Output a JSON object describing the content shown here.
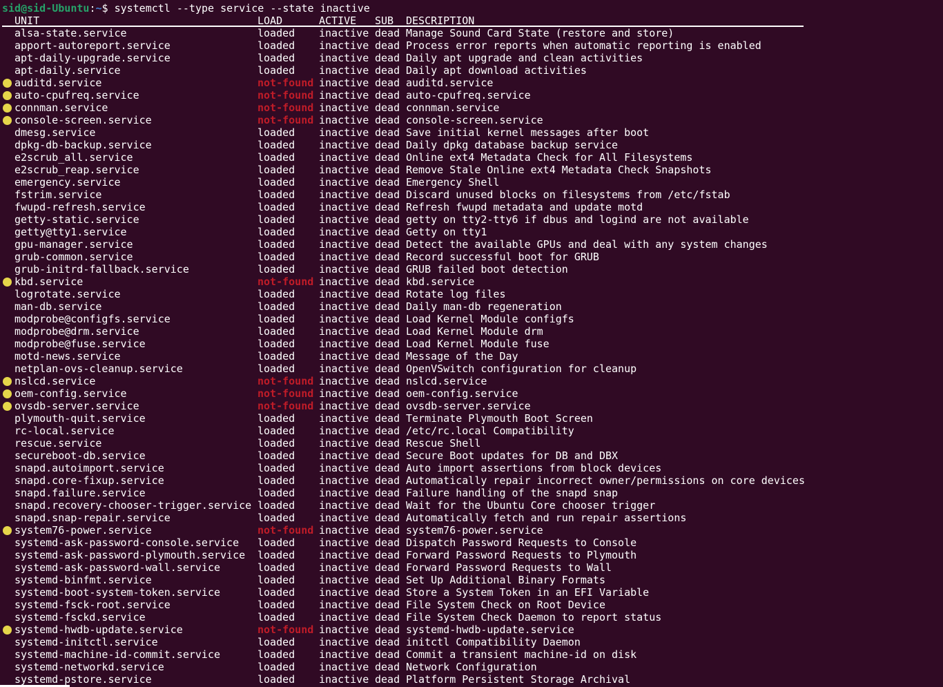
{
  "prompt": {
    "user_host": "sid@sid-Ubuntu",
    "separator": ":",
    "path": "~",
    "symbol": "$ ",
    "command": "systemctl --type service --state inactive"
  },
  "columns": {
    "unit": "UNIT",
    "load": "LOAD",
    "active": "ACTIVE",
    "sub": "SUB",
    "description": "DESCRIPTION"
  },
  "colors": {
    "background": "#300a24",
    "prompt_user": "#26a269",
    "prompt_path": "#3f7ecf",
    "not_found": "#c01c28",
    "warning_dot": "#e5d64a"
  },
  "rows": [
    {
      "unit": "alsa-state.service",
      "load": "loaded",
      "active": "inactive",
      "sub": "dead",
      "description": "Manage Sound Card State (restore and store)",
      "warn": false
    },
    {
      "unit": "apport-autoreport.service",
      "load": "loaded",
      "active": "inactive",
      "sub": "dead",
      "description": "Process error reports when automatic reporting is enabled",
      "warn": false
    },
    {
      "unit": "apt-daily-upgrade.service",
      "load": "loaded",
      "active": "inactive",
      "sub": "dead",
      "description": "Daily apt upgrade and clean activities",
      "warn": false
    },
    {
      "unit": "apt-daily.service",
      "load": "loaded",
      "active": "inactive",
      "sub": "dead",
      "description": "Daily apt download activities",
      "warn": false
    },
    {
      "unit": "auditd.service",
      "load": "not-found",
      "active": "inactive",
      "sub": "dead",
      "description": "auditd.service",
      "warn": true
    },
    {
      "unit": "auto-cpufreq.service",
      "load": "not-found",
      "active": "inactive",
      "sub": "dead",
      "description": "auto-cpufreq.service",
      "warn": true
    },
    {
      "unit": "connman.service",
      "load": "not-found",
      "active": "inactive",
      "sub": "dead",
      "description": "connman.service",
      "warn": true
    },
    {
      "unit": "console-screen.service",
      "load": "not-found",
      "active": "inactive",
      "sub": "dead",
      "description": "console-screen.service",
      "warn": true
    },
    {
      "unit": "dmesg.service",
      "load": "loaded",
      "active": "inactive",
      "sub": "dead",
      "description": "Save initial kernel messages after boot",
      "warn": false
    },
    {
      "unit": "dpkg-db-backup.service",
      "load": "loaded",
      "active": "inactive",
      "sub": "dead",
      "description": "Daily dpkg database backup service",
      "warn": false
    },
    {
      "unit": "e2scrub_all.service",
      "load": "loaded",
      "active": "inactive",
      "sub": "dead",
      "description": "Online ext4 Metadata Check for All Filesystems",
      "warn": false
    },
    {
      "unit": "e2scrub_reap.service",
      "load": "loaded",
      "active": "inactive",
      "sub": "dead",
      "description": "Remove Stale Online ext4 Metadata Check Snapshots",
      "warn": false
    },
    {
      "unit": "emergency.service",
      "load": "loaded",
      "active": "inactive",
      "sub": "dead",
      "description": "Emergency Shell",
      "warn": false
    },
    {
      "unit": "fstrim.service",
      "load": "loaded",
      "active": "inactive",
      "sub": "dead",
      "description": "Discard unused blocks on filesystems from /etc/fstab",
      "warn": false
    },
    {
      "unit": "fwupd-refresh.service",
      "load": "loaded",
      "active": "inactive",
      "sub": "dead",
      "description": "Refresh fwupd metadata and update motd",
      "warn": false
    },
    {
      "unit": "getty-static.service",
      "load": "loaded",
      "active": "inactive",
      "sub": "dead",
      "description": "getty on tty2-tty6 if dbus and logind are not available",
      "warn": false
    },
    {
      "unit": "getty@tty1.service",
      "load": "loaded",
      "active": "inactive",
      "sub": "dead",
      "description": "Getty on tty1",
      "warn": false
    },
    {
      "unit": "gpu-manager.service",
      "load": "loaded",
      "active": "inactive",
      "sub": "dead",
      "description": "Detect the available GPUs and deal with any system changes",
      "warn": false
    },
    {
      "unit": "grub-common.service",
      "load": "loaded",
      "active": "inactive",
      "sub": "dead",
      "description": "Record successful boot for GRUB",
      "warn": false
    },
    {
      "unit": "grub-initrd-fallback.service",
      "load": "loaded",
      "active": "inactive",
      "sub": "dead",
      "description": "GRUB failed boot detection",
      "warn": false
    },
    {
      "unit": "kbd.service",
      "load": "not-found",
      "active": "inactive",
      "sub": "dead",
      "description": "kbd.service",
      "warn": true
    },
    {
      "unit": "logrotate.service",
      "load": "loaded",
      "active": "inactive",
      "sub": "dead",
      "description": "Rotate log files",
      "warn": false
    },
    {
      "unit": "man-db.service",
      "load": "loaded",
      "active": "inactive",
      "sub": "dead",
      "description": "Daily man-db regeneration",
      "warn": false
    },
    {
      "unit": "modprobe@configfs.service",
      "load": "loaded",
      "active": "inactive",
      "sub": "dead",
      "description": "Load Kernel Module configfs",
      "warn": false
    },
    {
      "unit": "modprobe@drm.service",
      "load": "loaded",
      "active": "inactive",
      "sub": "dead",
      "description": "Load Kernel Module drm",
      "warn": false
    },
    {
      "unit": "modprobe@fuse.service",
      "load": "loaded",
      "active": "inactive",
      "sub": "dead",
      "description": "Load Kernel Module fuse",
      "warn": false
    },
    {
      "unit": "motd-news.service",
      "load": "loaded",
      "active": "inactive",
      "sub": "dead",
      "description": "Message of the Day",
      "warn": false
    },
    {
      "unit": "netplan-ovs-cleanup.service",
      "load": "loaded",
      "active": "inactive",
      "sub": "dead",
      "description": "OpenVSwitch configuration for cleanup",
      "warn": false
    },
    {
      "unit": "nslcd.service",
      "load": "not-found",
      "active": "inactive",
      "sub": "dead",
      "description": "nslcd.service",
      "warn": true
    },
    {
      "unit": "oem-config.service",
      "load": "not-found",
      "active": "inactive",
      "sub": "dead",
      "description": "oem-config.service",
      "warn": true
    },
    {
      "unit": "ovsdb-server.service",
      "load": "not-found",
      "active": "inactive",
      "sub": "dead",
      "description": "ovsdb-server.service",
      "warn": true
    },
    {
      "unit": "plymouth-quit.service",
      "load": "loaded",
      "active": "inactive",
      "sub": "dead",
      "description": "Terminate Plymouth Boot Screen",
      "warn": false
    },
    {
      "unit": "rc-local.service",
      "load": "loaded",
      "active": "inactive",
      "sub": "dead",
      "description": "/etc/rc.local Compatibility",
      "warn": false
    },
    {
      "unit": "rescue.service",
      "load": "loaded",
      "active": "inactive",
      "sub": "dead",
      "description": "Rescue Shell",
      "warn": false
    },
    {
      "unit": "secureboot-db.service",
      "load": "loaded",
      "active": "inactive",
      "sub": "dead",
      "description": "Secure Boot updates for DB and DBX",
      "warn": false
    },
    {
      "unit": "snapd.autoimport.service",
      "load": "loaded",
      "active": "inactive",
      "sub": "dead",
      "description": "Auto import assertions from block devices",
      "warn": false
    },
    {
      "unit": "snapd.core-fixup.service",
      "load": "loaded",
      "active": "inactive",
      "sub": "dead",
      "description": "Automatically repair incorrect owner/permissions on core devices",
      "warn": false
    },
    {
      "unit": "snapd.failure.service",
      "load": "loaded",
      "active": "inactive",
      "sub": "dead",
      "description": "Failure handling of the snapd snap",
      "warn": false
    },
    {
      "unit": "snapd.recovery-chooser-trigger.service",
      "load": "loaded",
      "active": "inactive",
      "sub": "dead",
      "description": "Wait for the Ubuntu Core chooser trigger",
      "warn": false
    },
    {
      "unit": "snapd.snap-repair.service",
      "load": "loaded",
      "active": "inactive",
      "sub": "dead",
      "description": "Automatically fetch and run repair assertions",
      "warn": false
    },
    {
      "unit": "system76-power.service",
      "load": "not-found",
      "active": "inactive",
      "sub": "dead",
      "description": "system76-power.service",
      "warn": true
    },
    {
      "unit": "systemd-ask-password-console.service",
      "load": "loaded",
      "active": "inactive",
      "sub": "dead",
      "description": "Dispatch Password Requests to Console",
      "warn": false
    },
    {
      "unit": "systemd-ask-password-plymouth.service",
      "load": "loaded",
      "active": "inactive",
      "sub": "dead",
      "description": "Forward Password Requests to Plymouth",
      "warn": false
    },
    {
      "unit": "systemd-ask-password-wall.service",
      "load": "loaded",
      "active": "inactive",
      "sub": "dead",
      "description": "Forward Password Requests to Wall",
      "warn": false
    },
    {
      "unit": "systemd-binfmt.service",
      "load": "loaded",
      "active": "inactive",
      "sub": "dead",
      "description": "Set Up Additional Binary Formats",
      "warn": false
    },
    {
      "unit": "systemd-boot-system-token.service",
      "load": "loaded",
      "active": "inactive",
      "sub": "dead",
      "description": "Store a System Token in an EFI Variable",
      "warn": false
    },
    {
      "unit": "systemd-fsck-root.service",
      "load": "loaded",
      "active": "inactive",
      "sub": "dead",
      "description": "File System Check on Root Device",
      "warn": false
    },
    {
      "unit": "systemd-fsckd.service",
      "load": "loaded",
      "active": "inactive",
      "sub": "dead",
      "description": "File System Check Daemon to report status",
      "warn": false
    },
    {
      "unit": "systemd-hwdb-update.service",
      "load": "not-found",
      "active": "inactive",
      "sub": "dead",
      "description": "systemd-hwdb-update.service",
      "warn": true
    },
    {
      "unit": "systemd-initctl.service",
      "load": "loaded",
      "active": "inactive",
      "sub": "dead",
      "description": "initctl Compatibility Daemon",
      "warn": false
    },
    {
      "unit": "systemd-machine-id-commit.service",
      "load": "loaded",
      "active": "inactive",
      "sub": "dead",
      "description": "Commit a transient machine-id on disk",
      "warn": false
    },
    {
      "unit": "systemd-networkd.service",
      "load": "loaded",
      "active": "inactive",
      "sub": "dead",
      "description": "Network Configuration",
      "warn": false
    },
    {
      "unit": "systemd-pstore.service",
      "load": "loaded",
      "active": "inactive",
      "sub": "dead",
      "description": "Platform Persistent Storage Archival",
      "warn": false
    }
  ]
}
